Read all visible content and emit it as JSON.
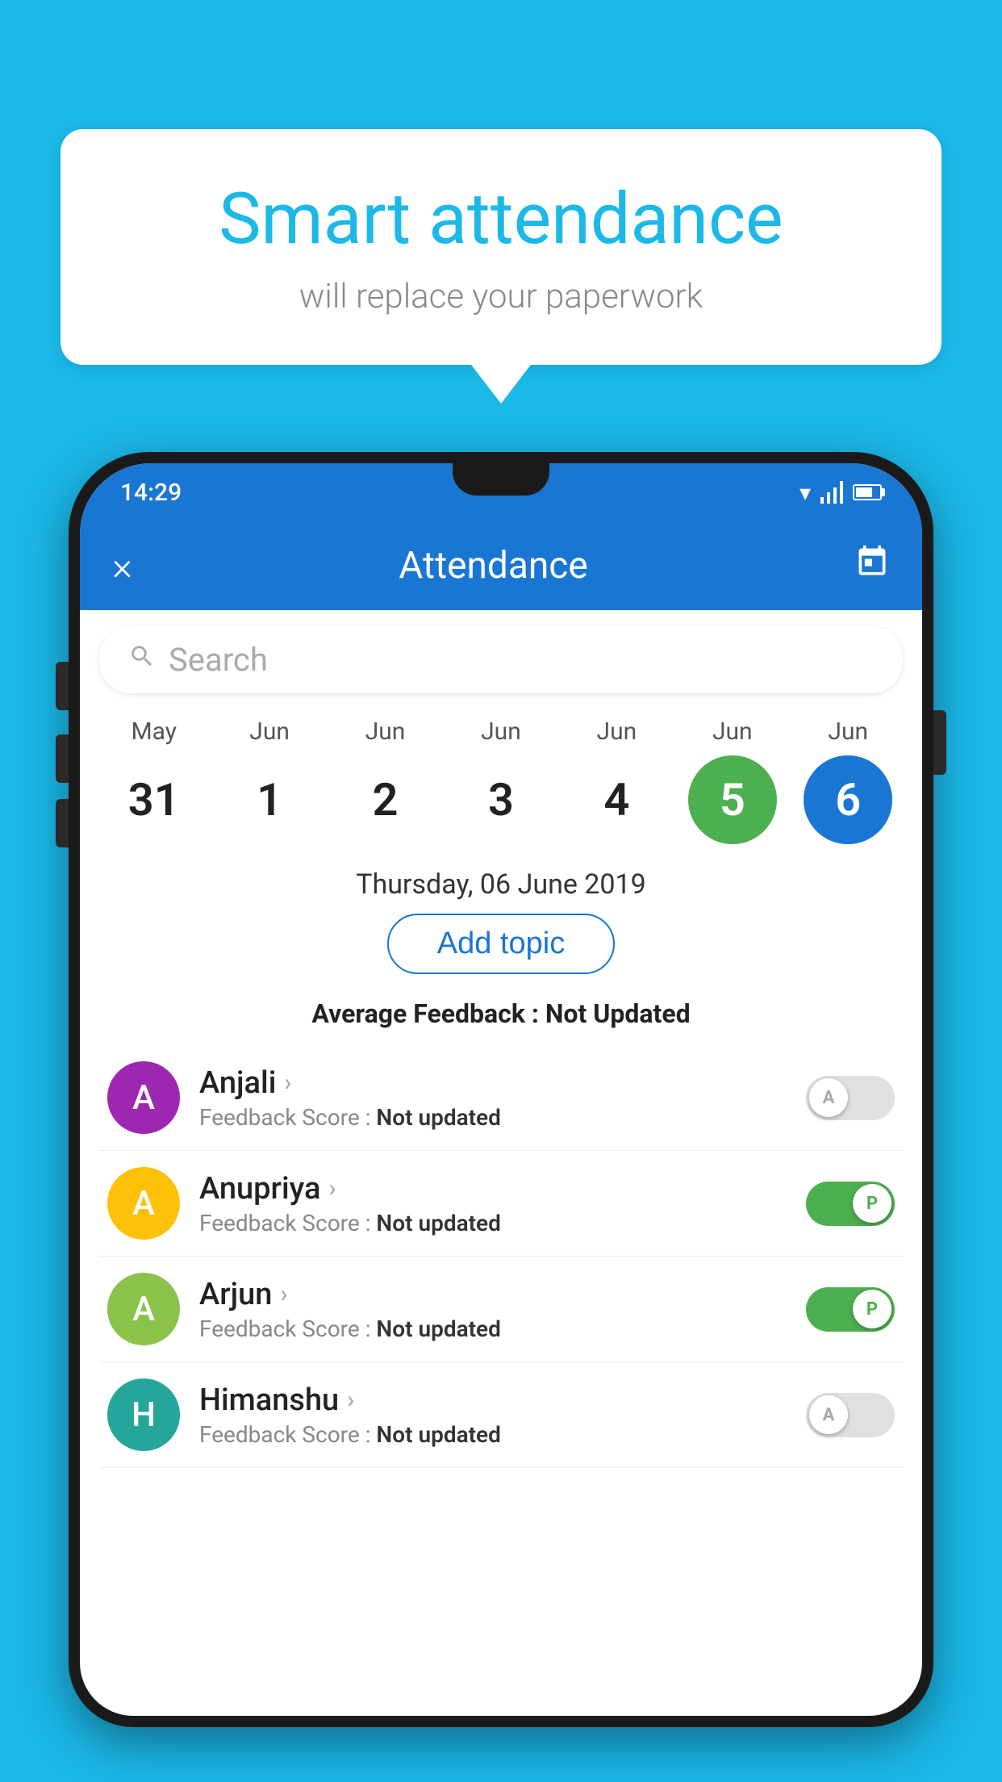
{
  "background_color": "#1BB8E8",
  "bubble": {
    "title": "Smart attendance",
    "subtitle": "will replace your paperwork"
  },
  "phone": {
    "status_bar": {
      "time": "14:29"
    },
    "app_bar": {
      "title": "Attendance",
      "close_label": "×",
      "calendar_label": "📅"
    },
    "search": {
      "placeholder": "Search"
    },
    "date_selector": {
      "dates": [
        {
          "month": "May",
          "day": "31",
          "style": "normal"
        },
        {
          "month": "Jun",
          "day": "1",
          "style": "normal"
        },
        {
          "month": "Jun",
          "day": "2",
          "style": "normal"
        },
        {
          "month": "Jun",
          "day": "3",
          "style": "normal"
        },
        {
          "month": "Jun",
          "day": "4",
          "style": "normal"
        },
        {
          "month": "Jun",
          "day": "5",
          "style": "today"
        },
        {
          "month": "Jun",
          "day": "6",
          "style": "selected"
        }
      ]
    },
    "selected_date_label": "Thursday, 06 June 2019",
    "add_topic_label": "Add topic",
    "avg_feedback_prefix": "Average Feedback : ",
    "avg_feedback_value": "Not Updated",
    "students": [
      {
        "name": "Anjali",
        "initial": "A",
        "avatar_color": "av-purple",
        "feedback_label": "Feedback Score : ",
        "feedback_value": "Not updated",
        "toggle": "off",
        "toggle_letter": "A"
      },
      {
        "name": "Anupriya",
        "initial": "A",
        "avatar_color": "av-yellow",
        "feedback_label": "Feedback Score : ",
        "feedback_value": "Not updated",
        "toggle": "on",
        "toggle_letter": "P"
      },
      {
        "name": "Arjun",
        "initial": "A",
        "avatar_color": "av-green-light",
        "feedback_label": "Feedback Score : ",
        "feedback_value": "Not updated",
        "toggle": "on",
        "toggle_letter": "P"
      },
      {
        "name": "Himanshu",
        "initial": "H",
        "avatar_color": "av-teal",
        "feedback_label": "Feedback Score : ",
        "feedback_value": "Not updated",
        "toggle": "off",
        "toggle_letter": "A"
      }
    ]
  }
}
